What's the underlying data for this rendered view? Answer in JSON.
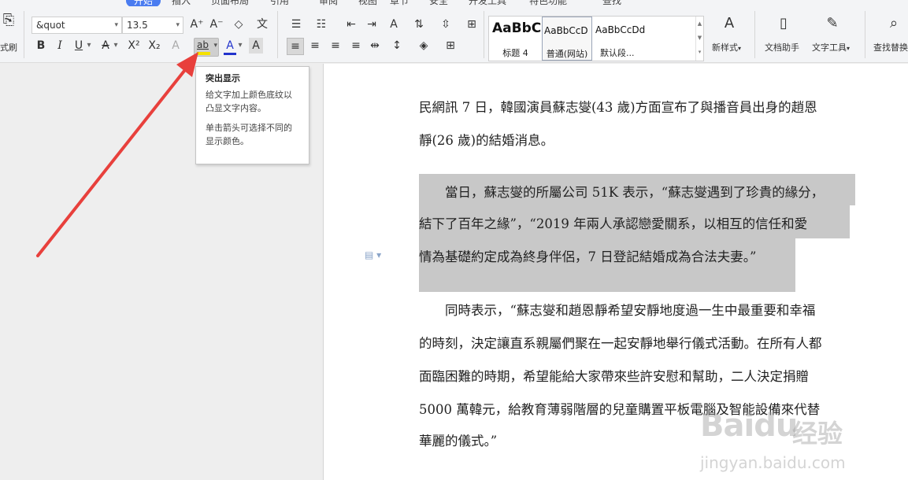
{
  "ribbon": {
    "tabs": [
      "开始",
      "插入",
      "页面布局",
      "引用",
      "审阅",
      "视图",
      "章节",
      "安全",
      "开发工具",
      "特色功能",
      "查找"
    ]
  },
  "toolbar": {
    "format_painter_label": "式刷",
    "font_name": "&quot",
    "font_size": "13.5",
    "styles": [
      {
        "sample": "AaBbC",
        "name": "标题 4"
      },
      {
        "sample": "AaBbCcD",
        "name": "普通(网站)"
      },
      {
        "sample": "AaBbCcDd",
        "name": "默认段..."
      }
    ],
    "new_style_label": "新样式",
    "doc_assistant_label": "文档助手",
    "text_tools_label": "文字工具",
    "find_replace_label": "查找替换",
    "highlight_color": "#f5e100",
    "font_color": "#2233cc"
  },
  "tooltip": {
    "title": "突出显示",
    "line1": "给文字加上颜色底纹以",
    "line2": "凸显文字内容。",
    "line3": "单击箭头可选择不同的",
    "line4": "显示颜色。"
  },
  "document": {
    "lines": [
      "民網訊  7 日，韓國演員蘇志燮(43 歲)方面宣布了與播音員出身的趙恩",
      "靜(26 歲)的結婚消息。",
      "　　當日，蘇志燮的所屬公司 51K 表示，“蘇志燮遇到了珍貴的緣分，",
      "結下了百年之緣”，“2019 年兩人承認戀愛關系，以相互的信任和愛",
      "情為基礎約定成為終身伴侶，7 日登記結婚成為合法夫妻。”",
      "　　同時表示，“蘇志燮和趙恩靜希望安靜地度過一生中最重要和幸福",
      "的時刻，決定讓直系親屬們聚在一起安靜地舉行儀式活動。在所有人都",
      "面臨困難的時期，希望能給大家帶來些許安慰和幫助，二人決定捐贈",
      "5000 萬韓元，給教育薄弱階層的兒童購置平板電腦及智能設備來代替",
      "華麗的儀式。”"
    ]
  },
  "watermark": {
    "logo": "Baidu",
    "cn": "经验",
    "url": "jingyan.baidu.com"
  },
  "annotation": {
    "arrow_color": "#e8403c"
  }
}
